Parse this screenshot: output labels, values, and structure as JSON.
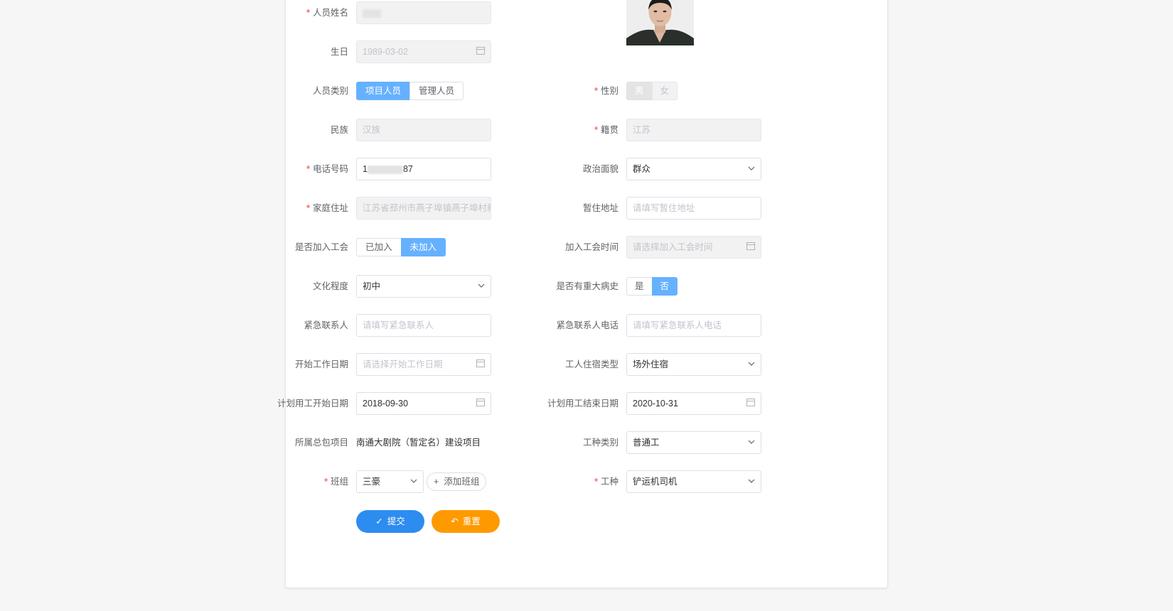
{
  "form": {
    "name": {
      "label": "人员姓名",
      "value": ""
    },
    "birthday": {
      "label": "生日",
      "value": "1989-03-02"
    },
    "category": {
      "label": "人员类别",
      "options": [
        "项目人员",
        "管理人员"
      ],
      "selected": "项目人员"
    },
    "gender": {
      "label": "性别",
      "options": [
        "男",
        "女"
      ],
      "selected": "男"
    },
    "ethnicity": {
      "label": "民族",
      "value": "汉族"
    },
    "native_place": {
      "label": "籍贯",
      "value": "江苏"
    },
    "phone": {
      "label": "电话号码",
      "prefix": "1",
      "suffix": "87"
    },
    "political": {
      "label": "政治面貌",
      "value": "群众"
    },
    "home_address": {
      "label": "家庭住址",
      "value": "江苏省邳州市燕子埠镇燕子埠村新("
    },
    "temp_address": {
      "label": "暂住地址",
      "placeholder": "请填写暂住地址"
    },
    "union_joined": {
      "label": "是否加入工会",
      "options": [
        "已加入",
        "未加入"
      ],
      "selected": "未加入"
    },
    "union_date": {
      "label": "加入工会时间",
      "placeholder": "请选择加入工会时间"
    },
    "education": {
      "label": "文化程度",
      "value": "初中"
    },
    "medical_history": {
      "label": "是否有重大病史",
      "options": [
        "是",
        "否"
      ],
      "selected": "否"
    },
    "emergency_contact": {
      "label": "紧急联系人",
      "placeholder": "请填写紧急联系人"
    },
    "emergency_phone": {
      "label": "紧急联系人电话",
      "placeholder": "请填写紧急联系人电话"
    },
    "start_work_date": {
      "label": "开始工作日期",
      "placeholder": "请选择开始工作日期"
    },
    "dorm_type": {
      "label": "工人住宿类型",
      "value": "场外住宿"
    },
    "plan_start": {
      "label": "计划用工开始日期",
      "value": "2018-09-30"
    },
    "plan_end": {
      "label": "计划用工结束日期",
      "value": "2020-10-31"
    },
    "general_project": {
      "label": "所属总包项目",
      "value": "南通大剧院（暂定名）建设项目"
    },
    "trade_category": {
      "label": "工种类别",
      "value": "普通工"
    },
    "team": {
      "label": "班组",
      "value": "三豪",
      "add_label": "添加班组"
    },
    "trade": {
      "label": "工种",
      "value": "铲运机司机"
    }
  },
  "actions": {
    "submit": "提交",
    "reset": "重置"
  },
  "colors": {
    "primary": "#2d8cf0",
    "active_option": "#66b1ff",
    "reset": "#ff9900",
    "required": "#f56c6c"
  },
  "icons": {
    "date": "calendar-icon",
    "select": "chevron-down-icon",
    "submit": "check-icon",
    "reset": "undo-icon",
    "add": "plus-icon"
  }
}
